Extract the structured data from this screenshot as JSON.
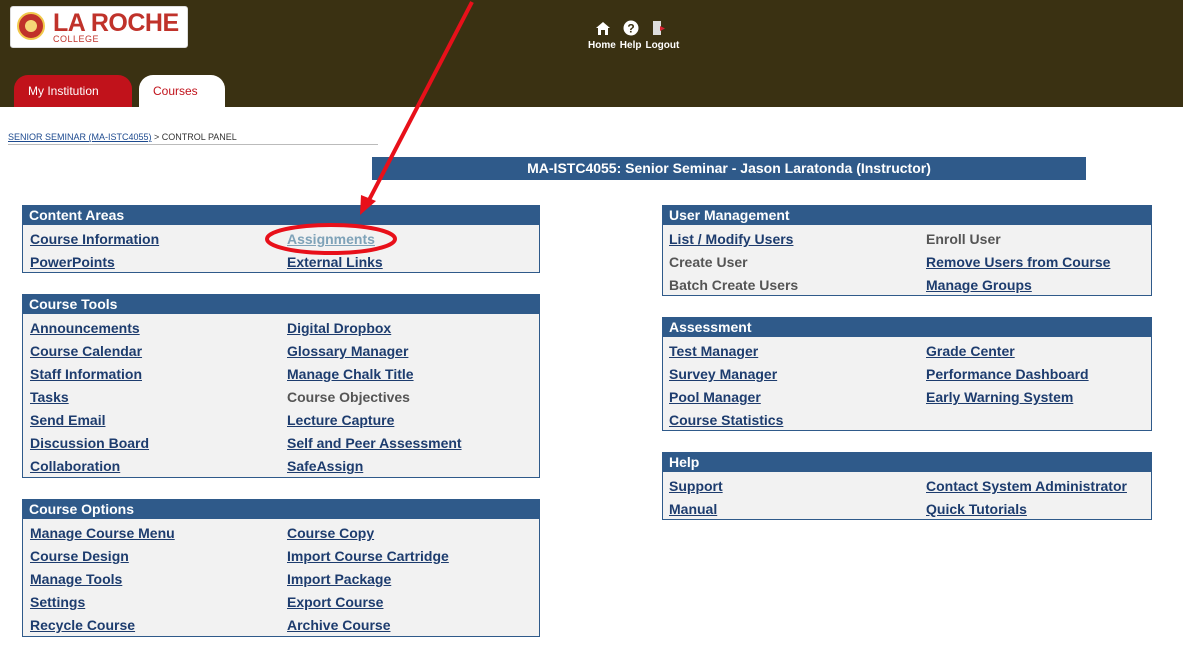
{
  "logo": {
    "name": "LA ROCHE",
    "sub": "COLLEGE"
  },
  "topnav": {
    "home": "Home",
    "help": "Help",
    "logout": "Logout"
  },
  "tabs": {
    "institution": "My Institution",
    "courses": "Courses"
  },
  "breadcrumb": {
    "course": "SENIOR SEMINAR (MA-ISTC4055)",
    "sep": " > ",
    "current": "CONTROL PANEL"
  },
  "page_title": "MA-ISTC4055: Senior Seminar - Jason Laratonda (Instructor)",
  "content_areas": {
    "title": "Content Areas",
    "items": [
      "Course Information",
      "Assignments",
      "PowerPoints",
      "External Links"
    ]
  },
  "course_tools": {
    "title": "Course Tools",
    "items": [
      "Announcements",
      "Digital Dropbox",
      "Course Calendar",
      "Glossary Manager",
      "Staff Information",
      "Manage Chalk Title",
      "Tasks",
      "Course Objectives",
      "Send Email",
      "Lecture Capture",
      "Discussion Board",
      "Self and Peer Assessment",
      "Collaboration",
      "SafeAssign"
    ]
  },
  "course_options": {
    "title": "Course Options",
    "items": [
      "Manage Course Menu",
      "Course Copy",
      "Course Design",
      "Import Course Cartridge",
      "Manage Tools",
      "Import Package",
      "Settings",
      "Export Course",
      "Recycle Course",
      "Archive Course"
    ]
  },
  "user_management": {
    "title": "User Management",
    "items": [
      "List / Modify Users",
      "Enroll User",
      "Create User",
      "Remove Users from Course",
      "Batch Create Users",
      "Manage Groups"
    ]
  },
  "assessment": {
    "title": "Assessment",
    "items": [
      "Test Manager",
      "Grade Center",
      "Survey Manager",
      "Performance Dashboard",
      "Pool Manager",
      "Early Warning System",
      "Course Statistics"
    ]
  },
  "help": {
    "title": "Help",
    "items": [
      "Support",
      "Contact System Administrator",
      "Manual",
      "Quick Tutorials"
    ]
  },
  "colors": {
    "header_bg": "#3a3112",
    "panel_blue": "#2f5a8a",
    "tab_red": "#c1121b",
    "annotation_red": "#e8101a"
  },
  "icons": [
    "home-icon",
    "help-icon",
    "logout-icon"
  ]
}
